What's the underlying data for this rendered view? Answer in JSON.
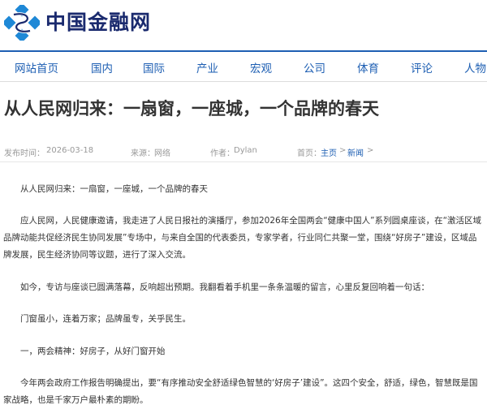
{
  "site": {
    "name": "中国金融网"
  },
  "nav": {
    "items": [
      "网站首页",
      "国内",
      "国际",
      "产业",
      "宏观",
      "公司",
      "体育",
      "评论",
      "人物"
    ]
  },
  "article": {
    "title": "从人民网归来：一扇窗，一座城，一个品牌的春天",
    "meta": {
      "date_label": "发布时间：",
      "date": "2026-03-18",
      "source_label": "来源：",
      "source": "网络",
      "author_label": "作者：",
      "author": "Dylan",
      "breadcrumb_label": "首页：",
      "breadcrumb_home": "主页",
      "breadcrumb_sep1": ">",
      "breadcrumb_section": "新闻",
      "breadcrumb_sep2": ">"
    },
    "paragraphs": [
      "从人民网归来：一扇窗，一座城，一个品牌的春天",
      "应人民网，人民健康邀请，我走进了人民日报社的演播厅，参加2026年全国两会“健康中国人”系列圆桌座谈，在“激活区域品牌动能共促经济民生协同发展”专场中，与来自全国的代表委员，专家学者，行业同仁共聚一堂，围绕“好房子”建设，区域品牌发展，民生经济协同等议题，进行了深入交流。",
      "如今，专访与座谈已圆满落幕，反响超出预期。我翻看着手机里一条条温暖的留言，心里反复回响着一句话：",
      "门窗虽小，连着万家；品牌虽专，关乎民生。",
      "一，两会精神：好房子，从好门窗开始",
      "今年两会政府工作报告明确提出，要“有序推动安全舒适绿色智慧的‘好房子’建设”。这四个安全，舒适，绿色，智慧既是国家战略，也是千家万户最朴素的期盼。"
    ]
  },
  "colors": {
    "brand": "#1a2a6e",
    "accent": "#1e5fb3",
    "logo_blue": "#1e88d6"
  }
}
